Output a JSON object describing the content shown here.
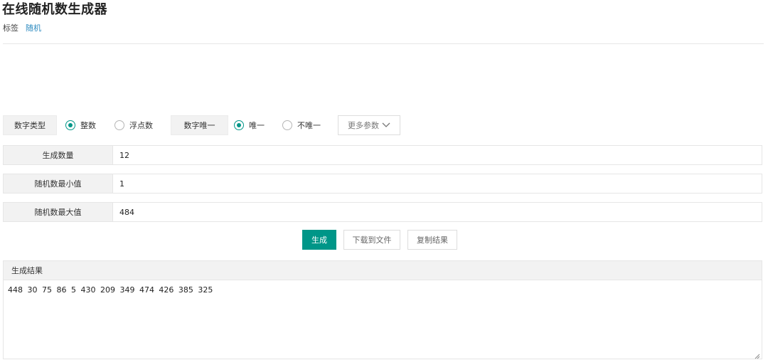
{
  "header": {
    "title": "在线随机数生成器",
    "tags_label": "标签",
    "tag": "随机"
  },
  "options": {
    "type_label": "数字类型",
    "type_options": [
      {
        "label": "整数",
        "checked": true
      },
      {
        "label": "浮点数",
        "checked": false
      }
    ],
    "unique_label": "数字唯一",
    "unique_options": [
      {
        "label": "唯一",
        "checked": true
      },
      {
        "label": "不唯一",
        "checked": false
      }
    ],
    "more_label": "更多参数"
  },
  "fields": {
    "count": {
      "label": "生成数量",
      "value": "12"
    },
    "min": {
      "label": "随机数最小值",
      "value": "1"
    },
    "max": {
      "label": "随机数最大值",
      "value": "484"
    }
  },
  "actions": {
    "generate": "生成",
    "download": "下载到文件",
    "copy": "复制结果"
  },
  "result": {
    "title": "生成结果",
    "text": "448 30 75 86 5 430 209 349 474 426 385 325"
  },
  "colors": {
    "accent": "#009688",
    "link": "#2e8bc0"
  }
}
